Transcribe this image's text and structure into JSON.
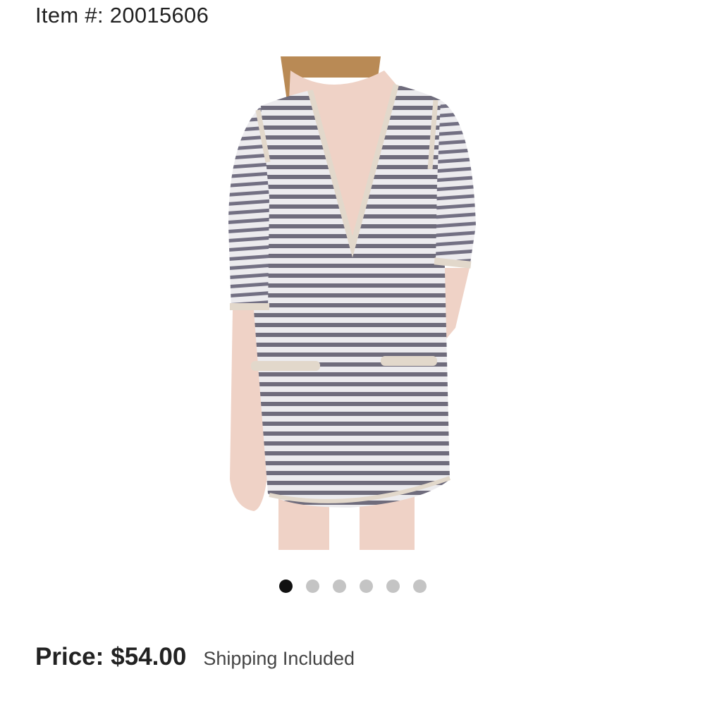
{
  "item": {
    "label": "Item #:",
    "number": "20015606"
  },
  "product_image": {
    "alt": "Striped gray and white long-sleeve henley dress with front pockets",
    "colors": {
      "stripe_dark": "#6f6c7c",
      "stripe_light": "#ecebee",
      "trim": "#e2d8cb",
      "skin": "#efd2c6",
      "hair": "#b98a55"
    }
  },
  "carousel": {
    "total": 6,
    "active_index": 0
  },
  "price": {
    "label": "Price:",
    "value": "$54.00",
    "shipping_note": "Shipping Included"
  }
}
